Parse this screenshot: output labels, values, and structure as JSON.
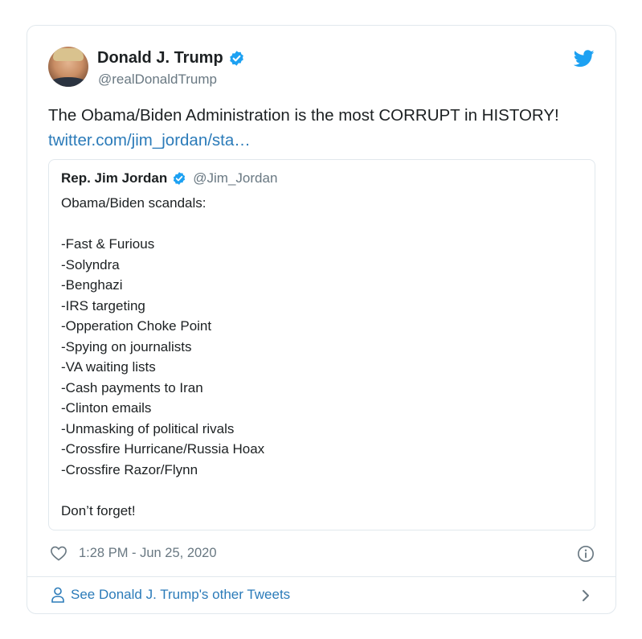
{
  "author": {
    "name": "Donald J. Trump",
    "handle": "@realDonaldTrump"
  },
  "tweet": {
    "text": "The Obama/Biden Administration is the most CORRUPT in HISTORY!",
    "link": "twitter.com/jim_jordan/sta…"
  },
  "quoted": {
    "name": "Rep. Jim Jordan",
    "handle": "@Jim_Jordan",
    "lines": [
      "Obama/Biden scandals:",
      "",
      "-Fast & Furious",
      "-Solyndra",
      "-Benghazi",
      "-IRS targeting",
      "-Opperation Choke Point",
      "-Spying on journalists",
      "-VA waiting lists",
      "-Cash payments to Iran",
      "-Clinton emails",
      "-Unmasking of political rivals",
      "-Crossfire Hurricane/Russia Hoax",
      "-Crossfire Razor/Flynn",
      "",
      "Don’t forget!"
    ]
  },
  "meta": {
    "timestamp": "1:28 PM - Jun 25, 2020"
  },
  "footer": {
    "label": "See Donald J. Trump's other Tweets"
  },
  "icons": {
    "verified": "verified-badge-icon",
    "bird": "twitter-bird-icon",
    "heart": "heart-icon",
    "info": "info-icon",
    "user": "user-icon",
    "chevron": "chevron-right-icon"
  },
  "colors": {
    "accent": "#1da1f2",
    "link": "#2b7bb9",
    "muted": "#697882",
    "border": "#e1e8ed"
  }
}
